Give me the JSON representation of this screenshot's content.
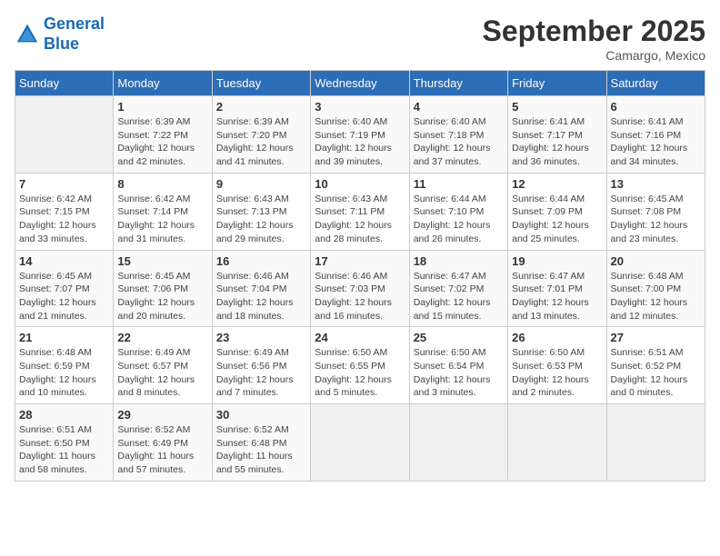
{
  "logo": {
    "line1": "General",
    "line2": "Blue"
  },
  "title": "September 2025",
  "subtitle": "Camargo, Mexico",
  "weekdays": [
    "Sunday",
    "Monday",
    "Tuesday",
    "Wednesday",
    "Thursday",
    "Friday",
    "Saturday"
  ],
  "weeks": [
    [
      {
        "day": "",
        "sunrise": "",
        "sunset": "",
        "daylight": ""
      },
      {
        "day": "1",
        "sunrise": "Sunrise: 6:39 AM",
        "sunset": "Sunset: 7:22 PM",
        "daylight": "Daylight: 12 hours and 42 minutes."
      },
      {
        "day": "2",
        "sunrise": "Sunrise: 6:39 AM",
        "sunset": "Sunset: 7:20 PM",
        "daylight": "Daylight: 12 hours and 41 minutes."
      },
      {
        "day": "3",
        "sunrise": "Sunrise: 6:40 AM",
        "sunset": "Sunset: 7:19 PM",
        "daylight": "Daylight: 12 hours and 39 minutes."
      },
      {
        "day": "4",
        "sunrise": "Sunrise: 6:40 AM",
        "sunset": "Sunset: 7:18 PM",
        "daylight": "Daylight: 12 hours and 37 minutes."
      },
      {
        "day": "5",
        "sunrise": "Sunrise: 6:41 AM",
        "sunset": "Sunset: 7:17 PM",
        "daylight": "Daylight: 12 hours and 36 minutes."
      },
      {
        "day": "6",
        "sunrise": "Sunrise: 6:41 AM",
        "sunset": "Sunset: 7:16 PM",
        "daylight": "Daylight: 12 hours and 34 minutes."
      }
    ],
    [
      {
        "day": "7",
        "sunrise": "Sunrise: 6:42 AM",
        "sunset": "Sunset: 7:15 PM",
        "daylight": "Daylight: 12 hours and 33 minutes."
      },
      {
        "day": "8",
        "sunrise": "Sunrise: 6:42 AM",
        "sunset": "Sunset: 7:14 PM",
        "daylight": "Daylight: 12 hours and 31 minutes."
      },
      {
        "day": "9",
        "sunrise": "Sunrise: 6:43 AM",
        "sunset": "Sunset: 7:13 PM",
        "daylight": "Daylight: 12 hours and 29 minutes."
      },
      {
        "day": "10",
        "sunrise": "Sunrise: 6:43 AM",
        "sunset": "Sunset: 7:11 PM",
        "daylight": "Daylight: 12 hours and 28 minutes."
      },
      {
        "day": "11",
        "sunrise": "Sunrise: 6:44 AM",
        "sunset": "Sunset: 7:10 PM",
        "daylight": "Daylight: 12 hours and 26 minutes."
      },
      {
        "day": "12",
        "sunrise": "Sunrise: 6:44 AM",
        "sunset": "Sunset: 7:09 PM",
        "daylight": "Daylight: 12 hours and 25 minutes."
      },
      {
        "day": "13",
        "sunrise": "Sunrise: 6:45 AM",
        "sunset": "Sunset: 7:08 PM",
        "daylight": "Daylight: 12 hours and 23 minutes."
      }
    ],
    [
      {
        "day": "14",
        "sunrise": "Sunrise: 6:45 AM",
        "sunset": "Sunset: 7:07 PM",
        "daylight": "Daylight: 12 hours and 21 minutes."
      },
      {
        "day": "15",
        "sunrise": "Sunrise: 6:45 AM",
        "sunset": "Sunset: 7:06 PM",
        "daylight": "Daylight: 12 hours and 20 minutes."
      },
      {
        "day": "16",
        "sunrise": "Sunrise: 6:46 AM",
        "sunset": "Sunset: 7:04 PM",
        "daylight": "Daylight: 12 hours and 18 minutes."
      },
      {
        "day": "17",
        "sunrise": "Sunrise: 6:46 AM",
        "sunset": "Sunset: 7:03 PM",
        "daylight": "Daylight: 12 hours and 16 minutes."
      },
      {
        "day": "18",
        "sunrise": "Sunrise: 6:47 AM",
        "sunset": "Sunset: 7:02 PM",
        "daylight": "Daylight: 12 hours and 15 minutes."
      },
      {
        "day": "19",
        "sunrise": "Sunrise: 6:47 AM",
        "sunset": "Sunset: 7:01 PM",
        "daylight": "Daylight: 12 hours and 13 minutes."
      },
      {
        "day": "20",
        "sunrise": "Sunrise: 6:48 AM",
        "sunset": "Sunset: 7:00 PM",
        "daylight": "Daylight: 12 hours and 12 minutes."
      }
    ],
    [
      {
        "day": "21",
        "sunrise": "Sunrise: 6:48 AM",
        "sunset": "Sunset: 6:59 PM",
        "daylight": "Daylight: 12 hours and 10 minutes."
      },
      {
        "day": "22",
        "sunrise": "Sunrise: 6:49 AM",
        "sunset": "Sunset: 6:57 PM",
        "daylight": "Daylight: 12 hours and 8 minutes."
      },
      {
        "day": "23",
        "sunrise": "Sunrise: 6:49 AM",
        "sunset": "Sunset: 6:56 PM",
        "daylight": "Daylight: 12 hours and 7 minutes."
      },
      {
        "day": "24",
        "sunrise": "Sunrise: 6:50 AM",
        "sunset": "Sunset: 6:55 PM",
        "daylight": "Daylight: 12 hours and 5 minutes."
      },
      {
        "day": "25",
        "sunrise": "Sunrise: 6:50 AM",
        "sunset": "Sunset: 6:54 PM",
        "daylight": "Daylight: 12 hours and 3 minutes."
      },
      {
        "day": "26",
        "sunrise": "Sunrise: 6:50 AM",
        "sunset": "Sunset: 6:53 PM",
        "daylight": "Daylight: 12 hours and 2 minutes."
      },
      {
        "day": "27",
        "sunrise": "Sunrise: 6:51 AM",
        "sunset": "Sunset: 6:52 PM",
        "daylight": "Daylight: 12 hours and 0 minutes."
      }
    ],
    [
      {
        "day": "28",
        "sunrise": "Sunrise: 6:51 AM",
        "sunset": "Sunset: 6:50 PM",
        "daylight": "Daylight: 11 hours and 58 minutes."
      },
      {
        "day": "29",
        "sunrise": "Sunrise: 6:52 AM",
        "sunset": "Sunset: 6:49 PM",
        "daylight": "Daylight: 11 hours and 57 minutes."
      },
      {
        "day": "30",
        "sunrise": "Sunrise: 6:52 AM",
        "sunset": "Sunset: 6:48 PM",
        "daylight": "Daylight: 11 hours and 55 minutes."
      },
      {
        "day": "",
        "sunrise": "",
        "sunset": "",
        "daylight": ""
      },
      {
        "day": "",
        "sunrise": "",
        "sunset": "",
        "daylight": ""
      },
      {
        "day": "",
        "sunrise": "",
        "sunset": "",
        "daylight": ""
      },
      {
        "day": "",
        "sunrise": "",
        "sunset": "",
        "daylight": ""
      }
    ]
  ]
}
